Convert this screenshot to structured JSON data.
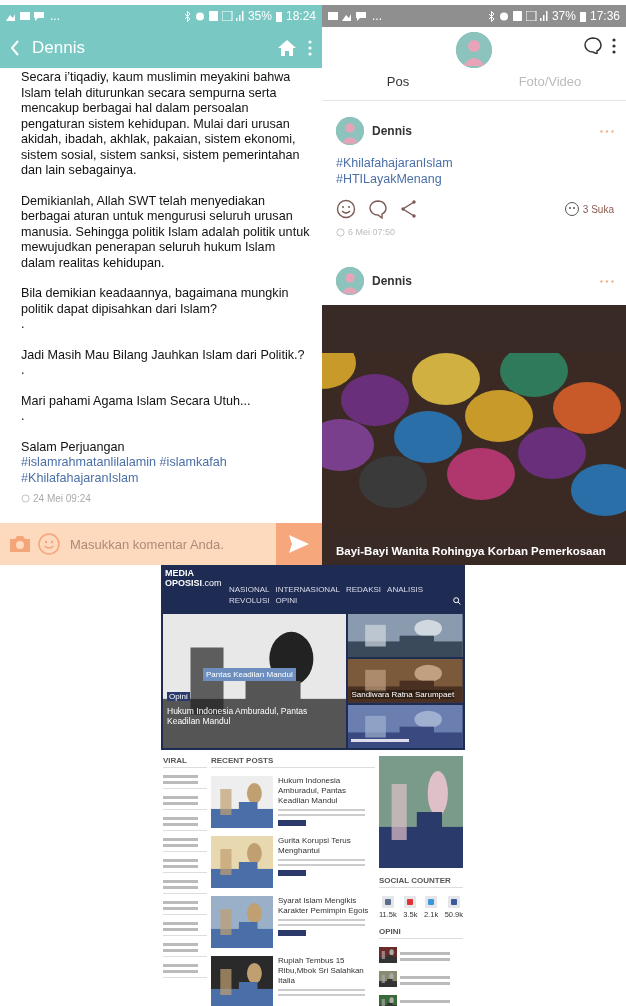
{
  "left_phone": {
    "status_bar": {
      "notifications_more": "...",
      "battery": "35%",
      "time": "18:24"
    },
    "app_bar": {
      "title": "Dennis"
    },
    "post_blocks": [
      [
        "Secara i’tiqadiy, kaum muslimin meyakini bahwa Islam telah diturunkan secara sempurna serta mencakup berbagai hal dalam persoalan pengaturan sistem kehidupan. Mulai dari urusan akidah, ibadah, akhlak, pakaian, sistem ekonomi, sistem sosial, sistem sanksi, sistem pemerintahan dan lain sebagainya."
      ],
      [
        "Demikianlah, Allah SWT telah menyediakan berbagai aturan untuk mengurusi seluruh urusan manusia. Sehingga politik Islam adalah politik untuk mewujudkan penerapan seluruh hukum Islam dalam realitas kehidupan."
      ],
      [
        "Bila demikian keadaannya, bagaimana mungkin politik dapat dipisahkan dari Islam?",
        "."
      ],
      [
        "Jadi Masih Mau Bilang Jauhkan Islam dari Politik.?",
        "."
      ],
      [
        "Mari pahami Agama Islam Secara Utuh...",
        "."
      ],
      [
        "Salam Perjuangan"
      ]
    ],
    "hashtags": [
      "#islamrahmatanlilalamin",
      "#islamkafah",
      "#KhilafahajaranIslam"
    ],
    "timestamp": "24 Mei 09:24",
    "comment_bar": {
      "placeholder": "Masukkan komentar Anda."
    }
  },
  "right_phone": {
    "status_bar": {
      "notifications_more": "...",
      "battery": "37%",
      "time": "17:36"
    },
    "tabs": [
      {
        "label": "Pos",
        "selected": true
      },
      {
        "label": "Foto/Video",
        "selected": false
      }
    ],
    "posts": [
      {
        "author": "Dennis",
        "hashtags": [
          "#KhilafahajaranIslam",
          "#HTILayakMenang"
        ],
        "likes": "3 Suka",
        "timestamp": "6 Mei 07:50"
      },
      {
        "author": "Dennis",
        "media": {
          "kind": "picture",
          "caption": "Bayi-Bayi Wanita Rohingya Korban Pemerkosaan"
        }
      }
    ]
  },
  "website": {
    "logo": {
      "line1": "MEDIA",
      "line2": "OPOSISI",
      "suffix": ".com"
    },
    "nav": [
      "NASIONAL",
      "INTERNASIONAL",
      "REDAKSI",
      "ANALISIS",
      "REVOLUSI",
      "OPINI"
    ],
    "slider": {
      "overlay": "Pantas Keadilan Mandul",
      "tag": "Opini",
      "headline": "Hukum Indonesia Amburadul, Pantas Keadilan Mandul"
    },
    "side_tiles": [
      "Sandiwara Ratna Sarumpaet"
    ],
    "viral": {
      "title": "VIRAL"
    },
    "recent": {
      "title": "RECENT POSTS",
      "posts": [
        "Hukum Indonesia Amburadul, Pantas Keadilan Mandul",
        "Gurita Korupsi Terus Menghantui",
        "Syarat Islam Mengikis Karakter Pemimpin Egois",
        "Rupiah Tembus 15 Ribu,Mbok Sri Salahkan Italia"
      ]
    },
    "social": {
      "title": "SOCIAL COUNTER",
      "counts": [
        "11.5k",
        "3.5k",
        "2.1k",
        "50.9k"
      ]
    },
    "opini": {
      "title": "OPINI"
    }
  }
}
